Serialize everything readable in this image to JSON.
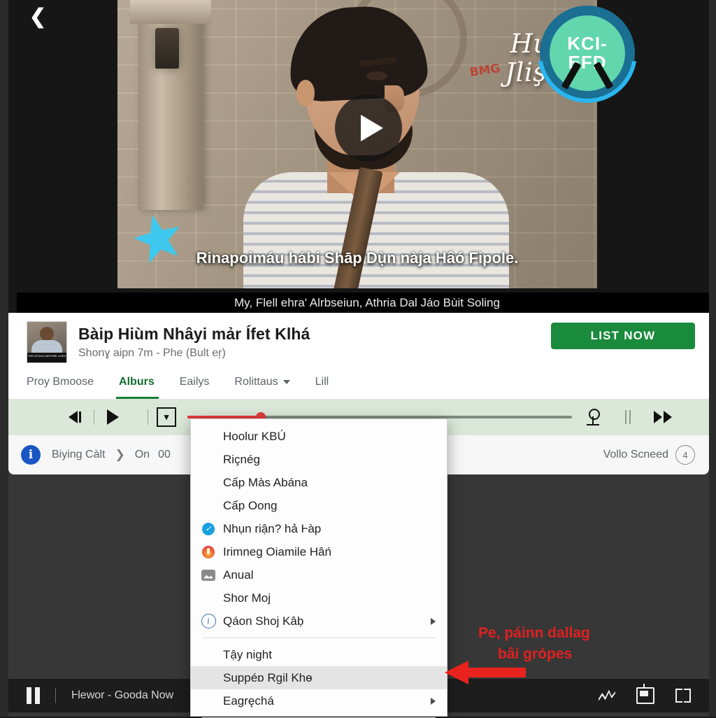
{
  "colors": {
    "accent_green": "#1a8a3c",
    "toolbar_bg": "#dbe8d9",
    "seek_red": "#e23b3b",
    "annotation_red": "#e02020",
    "badge_teal": "#62d6ad",
    "badge_ring_blue": "#1a6f92"
  },
  "video": {
    "back_icon": "back-chevron-icon",
    "play_icon": "play-icon",
    "overlay_script_line1": "Hupay",
    "overlay_script_line2": "Jlişclèn",
    "badge_line1": "KCI-",
    "badge_line2": "EFD",
    "shirt_logo": "BMG",
    "star_icon": "star-icon",
    "caption_main": "Rinapoimáu hábi Shāp Dụ̀n nàja Hâó Fipole.",
    "caption_sub": "My, Flell ehra' Alrbseiun, Athria Dal Jáo Bùit Soling"
  },
  "card": {
    "title": "Bàip Hiùm Nhâyi mảr Ífet Klhá",
    "subtitle": "Shonɣ aipn 7m - Phe (Bult eŗ)",
    "cta_label": "LIST NOW",
    "thumb_caption": "THE ATTACK BEFORE LIVES",
    "tabs": [
      {
        "label": "Proy Bmoose",
        "active": false,
        "has_chevron": false
      },
      {
        "label": "Alburs",
        "active": true,
        "has_chevron": false
      },
      {
        "label": "Eailys",
        "active": false,
        "has_chevron": false
      },
      {
        "label": "Rolittaus",
        "active": false,
        "has_chevron": true
      },
      {
        "label": "Lill",
        "active": false,
        "has_chevron": false
      }
    ]
  },
  "toolbar": {
    "prev_frame_icon": "prev-frame-icon",
    "play_icon": "play-icon",
    "marker_icon": "marker-box-icon",
    "anchor_icon": "anchor-icon",
    "pause_bars_icon": "pause-bars-icon",
    "fast_forward_icon": "fast-forward-icon",
    "seek_progress_percent": 19
  },
  "statusbar": {
    "info_icon": "info-icon",
    "crumb": "Biying Càlt",
    "separator_icon": "chevron-right-icon",
    "on_label": "On",
    "on_value": "00",
    "right_label": "Vollo Scneed",
    "right_badge": "4"
  },
  "menu": {
    "items": [
      {
        "label": "Hoolur KBÚ",
        "icon": null,
        "submenu": false,
        "highlighted": false,
        "separator_after": false
      },
      {
        "label": "Riçnég",
        "icon": null,
        "submenu": false,
        "highlighted": false,
        "separator_after": false
      },
      {
        "label": "Cấp Màs Abána",
        "icon": null,
        "submenu": false,
        "highlighted": false,
        "separator_after": false
      },
      {
        "label": "Cấp Oong",
        "icon": null,
        "submenu": false,
        "highlighted": false,
        "separator_after": false
      },
      {
        "label": "Nhụn riận? hả Ⱶàp",
        "icon": "blue-check-icon",
        "submenu": false,
        "highlighted": false,
        "separator_after": false
      },
      {
        "label": "Irimneg Oiamile Hâń",
        "icon": "flame-circle-icon",
        "submenu": false,
        "highlighted": false,
        "separator_after": false
      },
      {
        "label": "Anual",
        "icon": "image-icon",
        "submenu": false,
        "highlighted": false,
        "separator_after": false
      },
      {
        "label": "Shor Moj",
        "icon": null,
        "submenu": false,
        "highlighted": false,
        "separator_after": false
      },
      {
        "label": "Qáon Shoj Kâḅ",
        "icon": "info-circle-icon",
        "submenu": true,
        "highlighted": false,
        "separator_after": true
      },
      {
        "label": "Tậy night",
        "icon": null,
        "submenu": false,
        "highlighted": false,
        "separator_after": false
      },
      {
        "label": "Suppéɒ Rgil Khɵ",
        "icon": null,
        "submenu": false,
        "highlighted": true,
        "separator_after": false
      },
      {
        "label": "Eagręchá",
        "icon": null,
        "submenu": true,
        "highlighted": false,
        "separator_after": true
      }
    ]
  },
  "annotation": {
    "line1": "Pe, páinn dallag",
    "line2": "bâí grópes",
    "arrow_icon": "left-arrow-icon"
  },
  "bottombar": {
    "pause_icon": "pause-icon",
    "now_playing": "Ⱶlewor - Gooda Now",
    "wave_icon": "waveform-icon",
    "cast_icon": "cast-icon",
    "fullscreen_icon": "fullscreen-icon"
  }
}
